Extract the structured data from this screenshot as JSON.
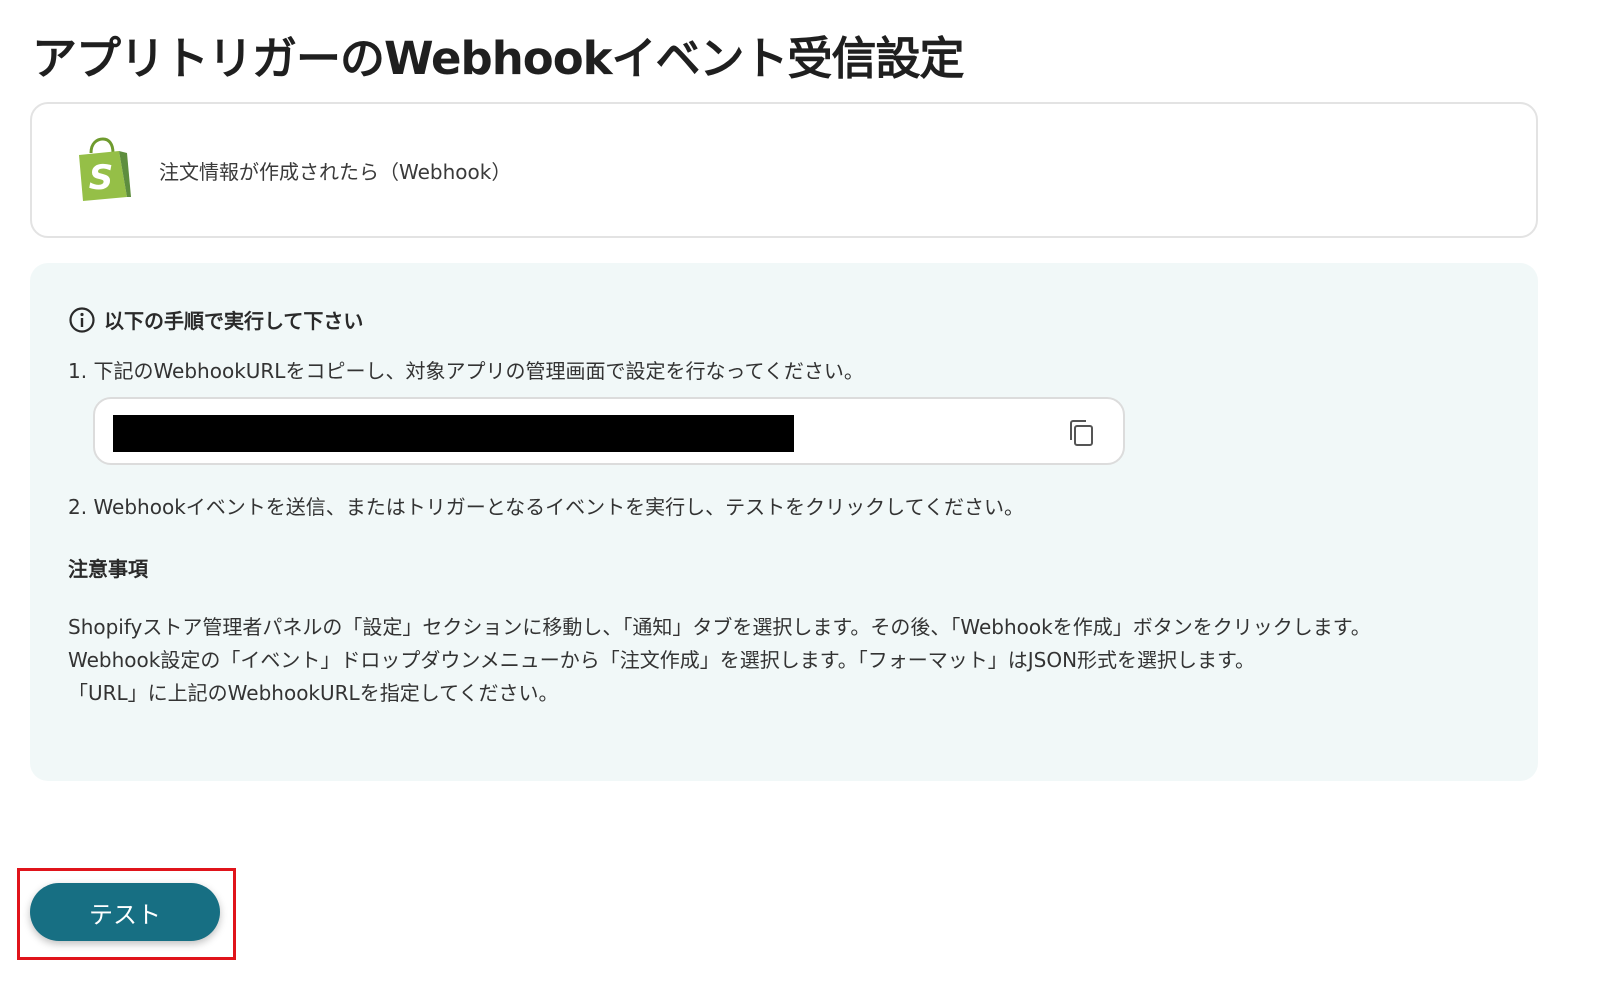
{
  "page": {
    "title": "アプリトリガーのWebhookイベント受信設定"
  },
  "trigger": {
    "icon": "shopify-bag-icon",
    "label": "注文情報が作成されたら（Webhook）",
    "brand_color": "#95bf47"
  },
  "instructions": {
    "header_icon": "info-icon",
    "header": "以下の手順で実行して下さい",
    "step1": "1. 下記のWebhookURLをコピーし、対象アプリの管理画面で設定を行なってください。",
    "url_copy_icon": "copy-icon",
    "step2": "2. Webhookイベントを送信、またはトリガーとなるイベントを実行し、テストをクリックしてください。"
  },
  "notes": {
    "title": "注意事項",
    "lines": [
      "Shopifyストア管理者パネルの「設定」セクションに移動し、「通知」タブを選択します。その後、「Webhookを作成」ボタンをクリックします。",
      "Webhook設定の「イベント」ドロップダウンメニューから「注文作成」を選択します。「フォーマット」はJSON形式を選択します。",
      "「URL」に上記のWebhookURLを指定してください。"
    ]
  },
  "actions": {
    "test_label": "テスト",
    "test_color": "#176f83",
    "highlight_color": "#e0141b"
  }
}
